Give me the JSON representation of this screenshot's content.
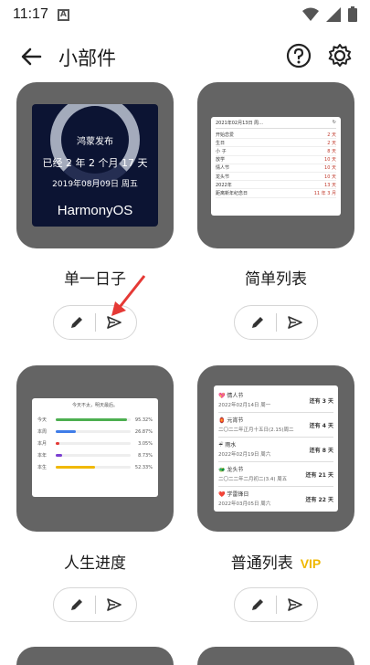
{
  "status": {
    "time": "11:17",
    "a": "A"
  },
  "header": {
    "title": "小部件"
  },
  "cards": [
    {
      "label": "单一日子",
      "preview": {
        "t1": "鸿蒙发布",
        "t2": "已经 2 年 2 个月 17 天",
        "t3": "2019年08月09日 周五",
        "logo": "HarmonyOS"
      }
    },
    {
      "label": "简单列表",
      "preview": {
        "header": "2021年02月13日 周…",
        "rows": [
          {
            "name": "开始恋爱",
            "val": "2 天"
          },
          {
            "name": "生日",
            "val": "2 天"
          },
          {
            "name": "小 子",
            "val": "8 天"
          },
          {
            "name": "放学",
            "val": "10 天"
          },
          {
            "name": "情人节",
            "val": "10 天"
          },
          {
            "name": "龙头节",
            "val": "10 天"
          },
          {
            "name": "2022年",
            "val": "13 天"
          },
          {
            "name": "距离新年纪念日",
            "val": "11 年 3 月"
          }
        ]
      }
    },
    {
      "label": "人生进度",
      "preview": {
        "caption": "今天不太，明天最后。",
        "rows": [
          {
            "name": "今天",
            "pct": "95.32%",
            "color": "#4caf50",
            "fill": 0.95
          },
          {
            "name": "本周",
            "pct": "26.87%",
            "color": "#3f7de8",
            "fill": 0.27
          },
          {
            "name": "本月",
            "pct": "3.05%",
            "color": "#e53935",
            "fill": 0.05
          },
          {
            "name": "本年",
            "pct": "8.73%",
            "color": "#7b3fd1",
            "fill": 0.09
          },
          {
            "name": "本生",
            "pct": "52.33%",
            "color": "#f0b800",
            "fill": 0.52
          }
        ]
      }
    },
    {
      "label": "普通列表",
      "vip": "VIP",
      "preview": {
        "items": [
          {
            "name": "💖 情人节",
            "date": "2022年02月14日 周一",
            "remain": "还有 3 天"
          },
          {
            "name": "🏮 元宵节",
            "date": "二〇二二年正月十五日(2.15)周二",
            "remain": "还有 4 天"
          },
          {
            "name": "☔ 雨水",
            "date": "2022年02月19日 周六",
            "remain": "还有 8 天"
          },
          {
            "name": "🐲 龙头节",
            "date": "二〇二二年二月初二(3.4) 周五",
            "remain": "还有 21 天"
          },
          {
            "name": "❤️ 学雷锋日",
            "date": "2022年03月05日 周六",
            "remain": "还有 22 天"
          }
        ]
      }
    }
  ]
}
